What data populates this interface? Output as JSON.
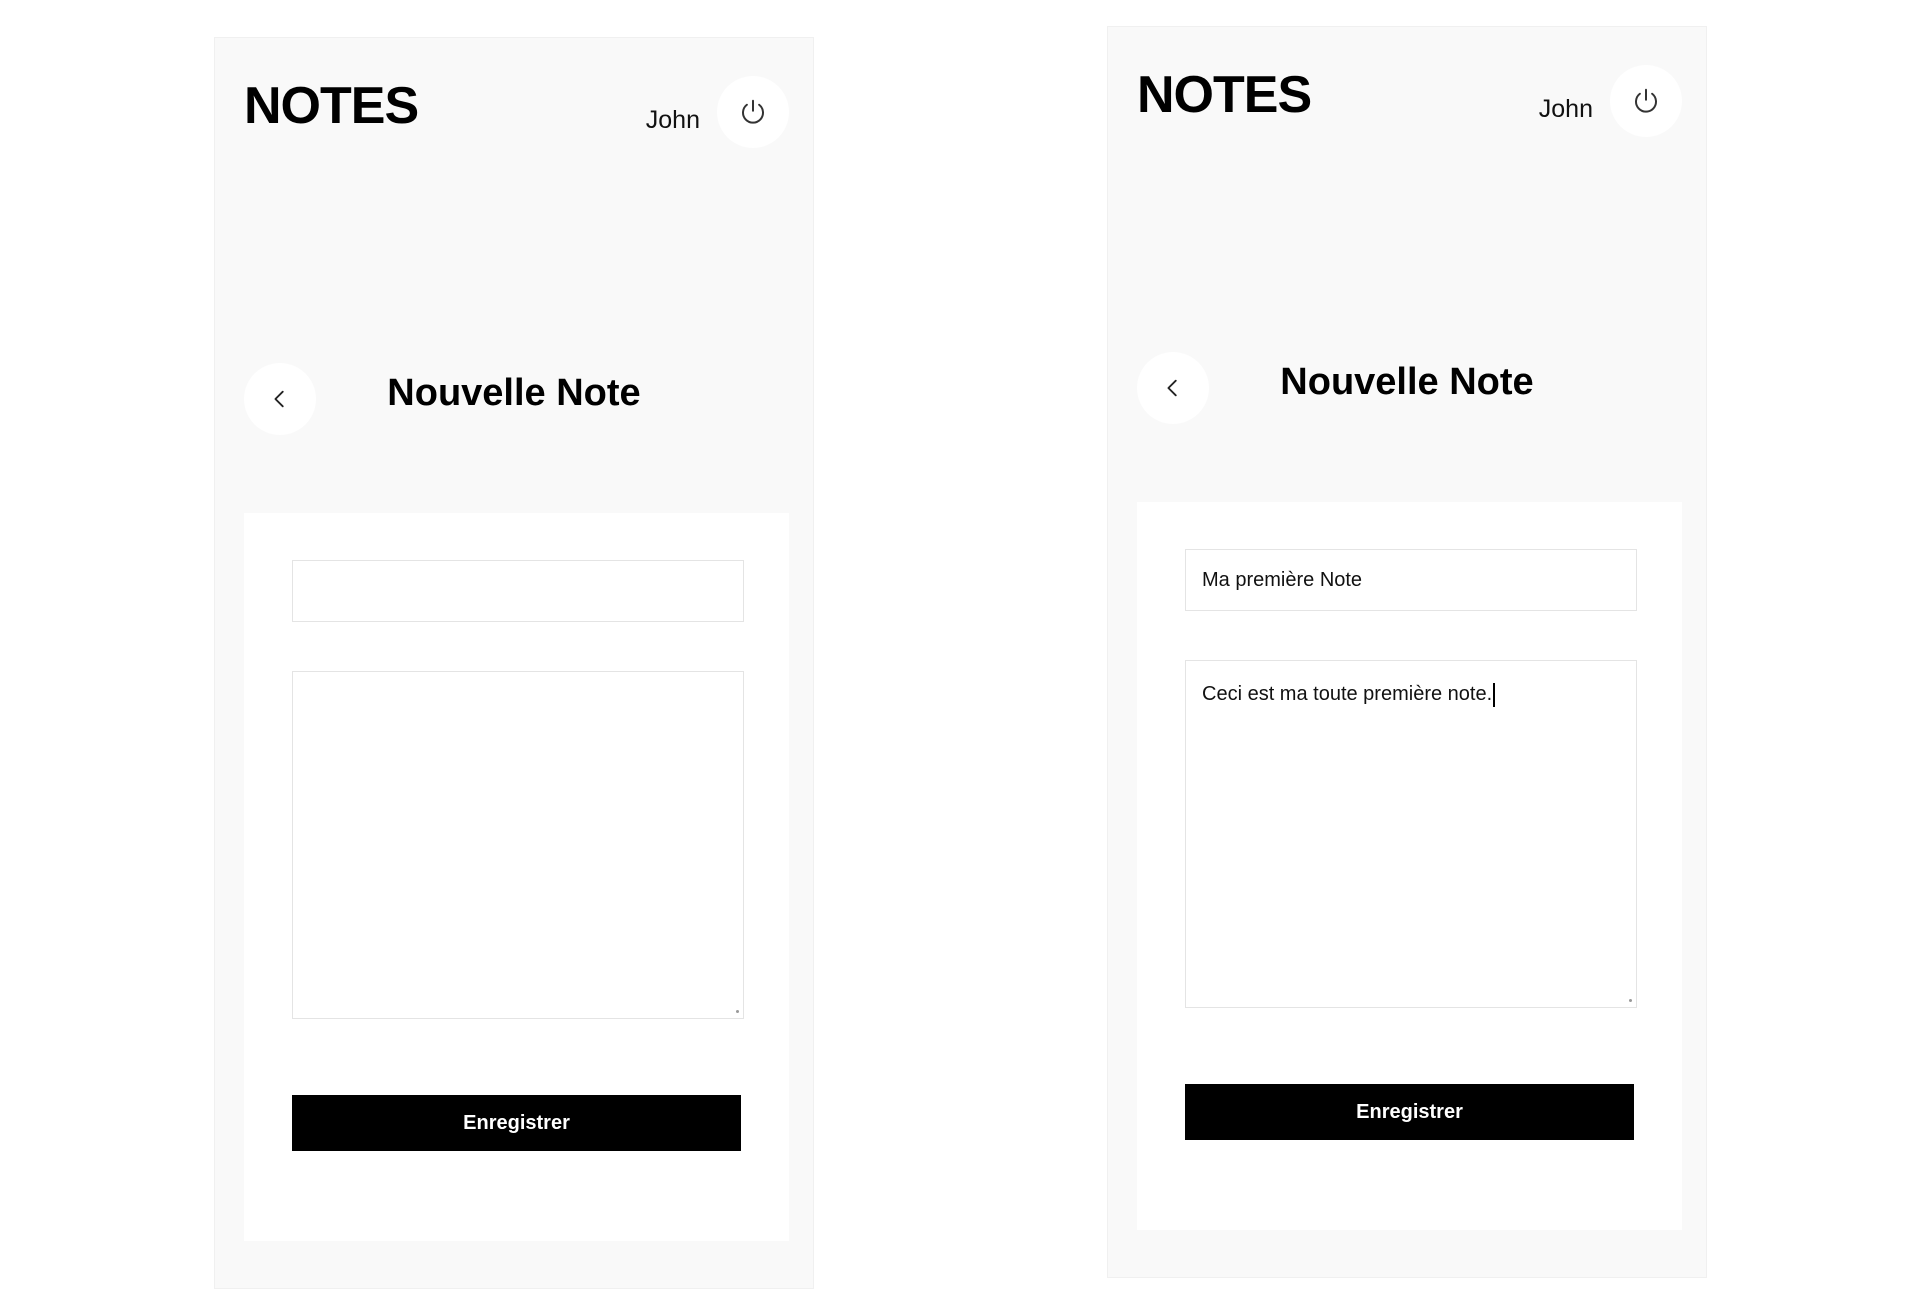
{
  "screens": [
    {
      "header": {
        "app_title": "NOTES",
        "user_name": "John",
        "power_icon": "power-icon"
      },
      "page": {
        "title": "Nouvelle Note",
        "back_icon": "chevron-left-icon"
      },
      "form": {
        "title_value": "",
        "body_value": "",
        "save_label": "Enregistrer"
      }
    },
    {
      "header": {
        "app_title": "NOTES",
        "user_name": "John",
        "power_icon": "power-icon"
      },
      "page": {
        "title": "Nouvelle Note",
        "back_icon": "chevron-left-icon"
      },
      "form": {
        "title_value": "Ma première Note",
        "body_value": "Ceci est ma toute première note.",
        "save_label": "Enregistrer"
      }
    }
  ],
  "colors": {
    "screen_background": "#f9f9f9",
    "card_background": "#ffffff",
    "button_background": "#000000",
    "button_text": "#ffffff"
  }
}
